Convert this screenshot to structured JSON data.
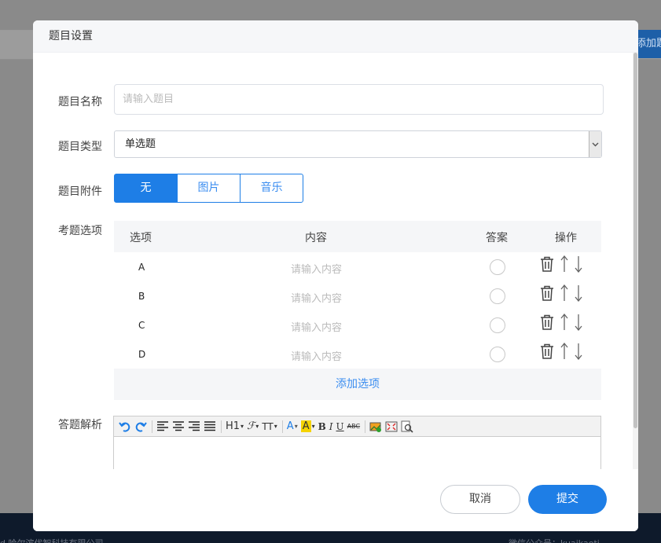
{
  "background": {
    "add_button_label": "添加题",
    "footer_left": "d 哈尔滨优智科技有限公司",
    "footer_right": "微信公众号：kuaikaoti"
  },
  "dialog": {
    "title": "题目设置",
    "name_label": "题目名称",
    "name_placeholder": "请输入题目",
    "type_label": "题目类型",
    "type_value": "单选题",
    "attachment_label": "题目附件",
    "attachment_options": [
      "无",
      "图片",
      "音乐"
    ],
    "attachment_selected": "无",
    "options_label": "考题选项",
    "table_headers": {
      "option": "选项",
      "content": "内容",
      "answer": "答案",
      "action": "操作"
    },
    "options": [
      {
        "letter": "A",
        "placeholder": "请输入内容"
      },
      {
        "letter": "B",
        "placeholder": "请输入内容"
      },
      {
        "letter": "C",
        "placeholder": "请输入内容"
      },
      {
        "letter": "D",
        "placeholder": "请输入内容"
      }
    ],
    "add_option_label": "添加选项",
    "analysis_label": "答题解析",
    "toolbar": {
      "heading": "H1",
      "font_size": "TT"
    },
    "cancel_label": "取消",
    "submit_label": "提交"
  },
  "colors": {
    "primary": "#1e7ee6",
    "link": "#3c8ef0",
    "footer_bg": "#0e1a2b"
  }
}
